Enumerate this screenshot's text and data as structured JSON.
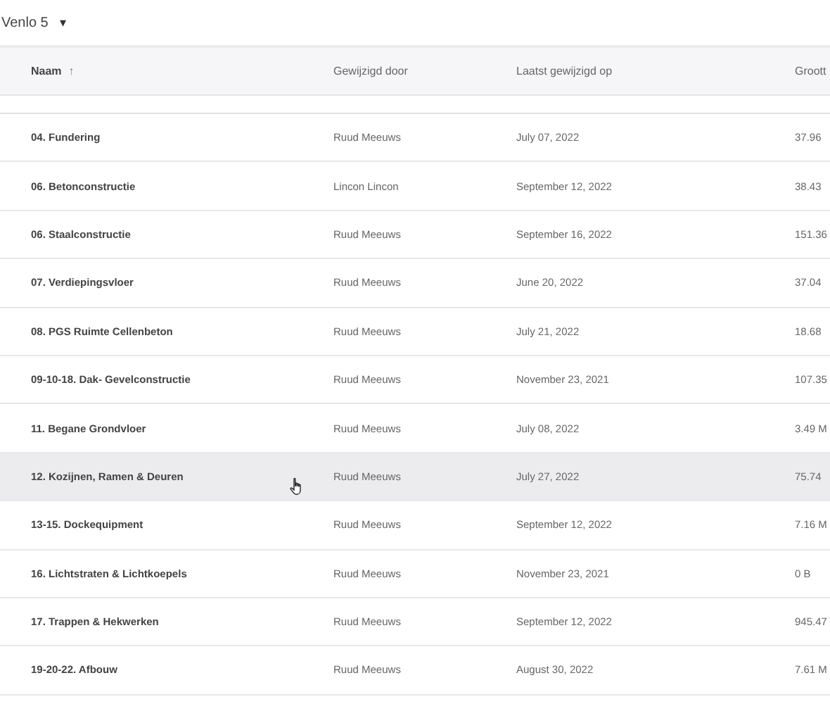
{
  "breadcrumb": {
    "label": "Venlo 5",
    "caret": "▾"
  },
  "table": {
    "columns": [
      {
        "label": "Naam",
        "sort": "↑"
      },
      {
        "label": "Gewijzigd door"
      },
      {
        "label": "Laatst gewijzigd op"
      },
      {
        "label": "Groott"
      }
    ],
    "rows": [
      {
        "name": "04. Fundering",
        "by": "Ruud Meeuws",
        "date": "July 07, 2022",
        "size": "37.96",
        "hovered": false
      },
      {
        "name": "06. Betonconstructie",
        "by": "Lincon Lincon",
        "date": "September 12, 2022",
        "size": "38.43",
        "hovered": false
      },
      {
        "name": "06. Staalconstructie",
        "by": "Ruud Meeuws",
        "date": "September 16, 2022",
        "size": "151.36",
        "hovered": false
      },
      {
        "name": "07. Verdiepingsvloer",
        "by": "Ruud Meeuws",
        "date": "June 20, 2022",
        "size": "37.04",
        "hovered": false
      },
      {
        "name": "08. PGS Ruimte Cellenbeton",
        "by": "Ruud Meeuws",
        "date": "July 21, 2022",
        "size": "18.68",
        "hovered": false
      },
      {
        "name": "09-10-18. Dak- Gevelconstructie",
        "by": "Ruud Meeuws",
        "date": "November 23, 2021",
        "size": "107.35",
        "hovered": false
      },
      {
        "name": "11. Begane Grondvloer",
        "by": "Ruud Meeuws",
        "date": "July 08, 2022",
        "size": "3.49 M",
        "hovered": false
      },
      {
        "name": "12. Kozijnen, Ramen & Deuren",
        "by": "Ruud Meeuws",
        "date": "July 27, 2022",
        "size": "75.74",
        "hovered": true
      },
      {
        "name": "13-15. Dockequipment",
        "by": "Ruud Meeuws",
        "date": "September 12, 2022",
        "size": "7.16 M",
        "hovered": false
      },
      {
        "name": "16. Lichtstraten & Lichtkoepels",
        "by": "Ruud Meeuws",
        "date": "November 23, 2021",
        "size": "0 B",
        "hovered": false
      },
      {
        "name": "17. Trappen & Hekwerken",
        "by": "Ruud Meeuws",
        "date": "September 12, 2022",
        "size": "945.47",
        "hovered": false
      },
      {
        "name": "19-20-22. Afbouw",
        "by": "Ruud Meeuws",
        "date": "August 30, 2022",
        "size": "7.61 M",
        "hovered": false
      }
    ]
  }
}
